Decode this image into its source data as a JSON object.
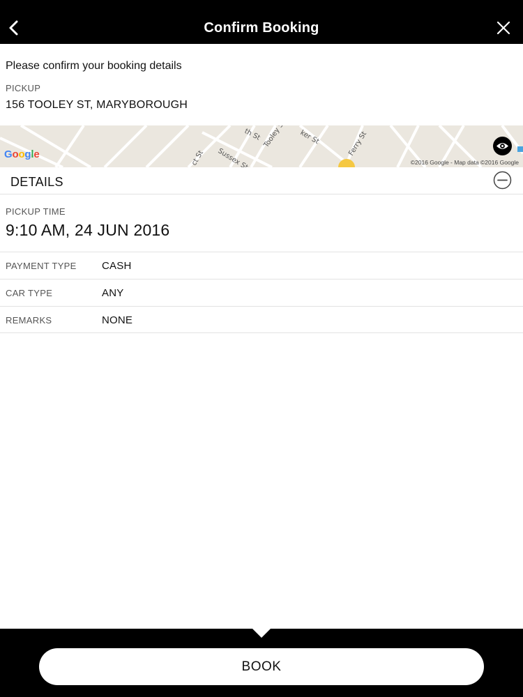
{
  "header": {
    "title": "Confirm Booking",
    "back_icon": "chevron-left-icon",
    "close_icon": "close-icon"
  },
  "booking": {
    "intro": "Please confirm your booking details",
    "pickup_label": "PICKUP",
    "pickup_address": "156 TOOLEY ST, MARYBOROUGH"
  },
  "map": {
    "logo": "Google",
    "credit": "©2016 Google - Map data ©2016 Google",
    "streets": [
      "th St",
      "Tooley St",
      "ker St",
      "Ferry St",
      "ct St",
      "Sussex St"
    ],
    "eye_icon": "eye-icon"
  },
  "details": {
    "title": "DETAILS",
    "collapse_icon": "minus-circle-icon",
    "pickup_time_label": "PICKUP TIME",
    "pickup_time_value": "9:10 AM, 24 JUN 2016",
    "rows": [
      {
        "label": "PAYMENT TYPE",
        "value": "CASH"
      },
      {
        "label": "CAR TYPE",
        "value": "ANY"
      },
      {
        "label": "REMARKS",
        "value": "NONE"
      }
    ]
  },
  "footer": {
    "book_label": "BOOK"
  },
  "colors": {
    "header_bg": "#000000",
    "map_bg": "#ebe7df",
    "divider": "#e2e2e2"
  }
}
